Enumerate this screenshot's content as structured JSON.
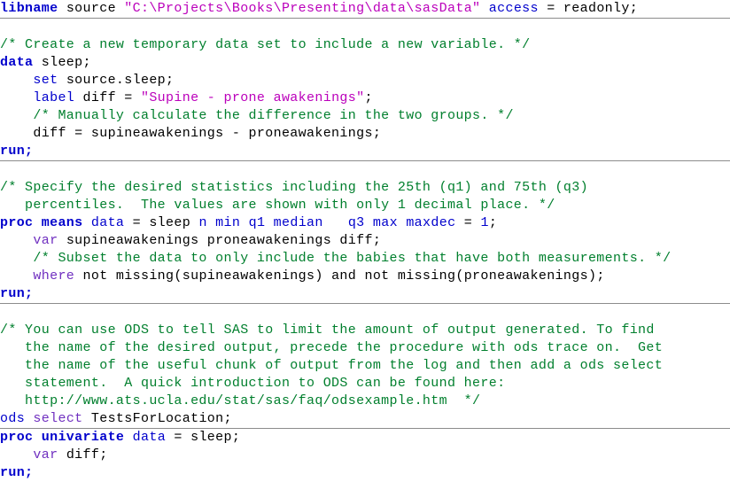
{
  "editor": {
    "title": "SAS Code Editor",
    "language": "SAS",
    "background_color": "#ffffff",
    "separator_color": "#8c8c8c",
    "colors": {
      "keyword": "#0000cc",
      "keyword_secondary": "#7030c0",
      "string": "#bb00bb",
      "comment": "#007f2d",
      "number": "#0000cc",
      "plain_text": "#000000"
    }
  },
  "lines": [
    {
      "id": "line-1",
      "rule_below": true,
      "tokens": [
        {
          "t": "libname",
          "c": "kw"
        },
        {
          "t": " source ",
          "c": "plain"
        },
        {
          "t": "\"C:\\Projects\\Books\\Presenting\\data\\sasData\"",
          "c": "str"
        },
        {
          "t": " ",
          "c": "plain"
        },
        {
          "t": "access",
          "c": "kw2"
        },
        {
          "t": " = readonly;",
          "c": "plain"
        }
      ]
    },
    {
      "id": "line-2",
      "rule_below": false,
      "tokens": [
        {
          "t": " ",
          "c": "plain"
        }
      ]
    },
    {
      "id": "line-3",
      "rule_below": false,
      "tokens": [
        {
          "t": "/* Create a new temporary data set to include a new variable. */",
          "c": "cmt"
        }
      ]
    },
    {
      "id": "line-4",
      "rule_below": false,
      "tokens": [
        {
          "t": "data",
          "c": "kw"
        },
        {
          "t": " sleep;",
          "c": "plain"
        }
      ]
    },
    {
      "id": "line-5",
      "rule_below": false,
      "tokens": [
        {
          "t": "    ",
          "c": "plain"
        },
        {
          "t": "set",
          "c": "kw2"
        },
        {
          "t": " source.sleep;",
          "c": "plain"
        }
      ]
    },
    {
      "id": "line-6",
      "rule_below": false,
      "tokens": [
        {
          "t": "    ",
          "c": "plain"
        },
        {
          "t": "label",
          "c": "kw2"
        },
        {
          "t": " diff = ",
          "c": "plain"
        },
        {
          "t": "\"Supine - prone awakenings\"",
          "c": "str"
        },
        {
          "t": ";",
          "c": "plain"
        }
      ]
    },
    {
      "id": "line-7",
      "rule_below": false,
      "tokens": [
        {
          "t": "    ",
          "c": "plain"
        },
        {
          "t": "/* Manually calculate the difference in the two groups. */",
          "c": "cmt"
        }
      ]
    },
    {
      "id": "line-8",
      "rule_below": false,
      "tokens": [
        {
          "t": "    diff = supineawakenings - proneawakenings;",
          "c": "plain"
        }
      ]
    },
    {
      "id": "line-9",
      "rule_below": true,
      "tokens": [
        {
          "t": "run;",
          "c": "kw"
        }
      ]
    },
    {
      "id": "line-10",
      "rule_below": false,
      "tokens": [
        {
          "t": " ",
          "c": "plain"
        }
      ]
    },
    {
      "id": "line-11",
      "rule_below": false,
      "tokens": [
        {
          "t": "/* Specify the desired statistics including the 25th (q1) and 75th (q3)",
          "c": "cmt"
        }
      ]
    },
    {
      "id": "line-12",
      "rule_below": false,
      "tokens": [
        {
          "t": "   percentiles.  The values are shown with only 1 decimal place. */",
          "c": "cmt"
        }
      ]
    },
    {
      "id": "line-13",
      "rule_below": false,
      "tokens": [
        {
          "t": "proc means",
          "c": "kw"
        },
        {
          "t": " ",
          "c": "plain"
        },
        {
          "t": "data",
          "c": "kw2"
        },
        {
          "t": " = sleep ",
          "c": "plain"
        },
        {
          "t": "n",
          "c": "kw2"
        },
        {
          "t": " ",
          "c": "plain"
        },
        {
          "t": "min",
          "c": "kw2"
        },
        {
          "t": " ",
          "c": "plain"
        },
        {
          "t": "q1",
          "c": "kw2"
        },
        {
          "t": " ",
          "c": "plain"
        },
        {
          "t": "median",
          "c": "kw2"
        },
        {
          "t": "   ",
          "c": "plain"
        },
        {
          "t": "q3",
          "c": "kw2"
        },
        {
          "t": " ",
          "c": "plain"
        },
        {
          "t": "max",
          "c": "kw2"
        },
        {
          "t": " ",
          "c": "plain"
        },
        {
          "t": "maxdec",
          "c": "kw2"
        },
        {
          "t": " = ",
          "c": "plain"
        },
        {
          "t": "1",
          "c": "num"
        },
        {
          "t": ";",
          "c": "plain"
        }
      ]
    },
    {
      "id": "line-14",
      "rule_below": false,
      "tokens": [
        {
          "t": "    ",
          "c": "plain"
        },
        {
          "t": "var",
          "c": "opt"
        },
        {
          "t": " supineawakenings proneawakenings diff;",
          "c": "plain"
        }
      ]
    },
    {
      "id": "line-15",
      "rule_below": false,
      "tokens": [
        {
          "t": "    ",
          "c": "plain"
        },
        {
          "t": "/* Subset the data to only include the babies that have both measurements. */",
          "c": "cmt"
        }
      ]
    },
    {
      "id": "line-16",
      "rule_below": false,
      "tokens": [
        {
          "t": "    ",
          "c": "plain"
        },
        {
          "t": "where",
          "c": "opt"
        },
        {
          "t": " not missing(supineawakenings) and not missing(proneawakenings);",
          "c": "plain"
        }
      ]
    },
    {
      "id": "line-17",
      "rule_below": true,
      "tokens": [
        {
          "t": "run;",
          "c": "kw"
        }
      ]
    },
    {
      "id": "line-18",
      "rule_below": false,
      "tokens": [
        {
          "t": " ",
          "c": "plain"
        }
      ]
    },
    {
      "id": "line-19",
      "rule_below": false,
      "tokens": [
        {
          "t": "/* You can use ODS to tell SAS to limit the amount of output generated. To find",
          "c": "cmt"
        }
      ]
    },
    {
      "id": "line-20",
      "rule_below": false,
      "tokens": [
        {
          "t": "   the name of the desired output, precede the procedure with ods trace on.  Get",
          "c": "cmt"
        }
      ]
    },
    {
      "id": "line-21",
      "rule_below": false,
      "tokens": [
        {
          "t": "   the name of the useful chunk of output from the log and then add a ods select",
          "c": "cmt"
        }
      ]
    },
    {
      "id": "line-22",
      "rule_below": false,
      "tokens": [
        {
          "t": "   statement.  A quick introduction to ODS can be found here:",
          "c": "cmt"
        }
      ]
    },
    {
      "id": "line-23",
      "rule_below": false,
      "tokens": [
        {
          "t": "   http://www.ats.ucla.edu/stat/sas/faq/odsexample.htm  */",
          "c": "cmt"
        }
      ]
    },
    {
      "id": "line-24",
      "rule_below": true,
      "tokens": [
        {
          "t": "ods",
          "c": "kw2"
        },
        {
          "t": " ",
          "c": "plain"
        },
        {
          "t": "select",
          "c": "opt"
        },
        {
          "t": " TestsForLocation;",
          "c": "plain"
        }
      ]
    },
    {
      "id": "line-25",
      "rule_below": false,
      "tokens": [
        {
          "t": "proc univariate",
          "c": "kw"
        },
        {
          "t": " ",
          "c": "plain"
        },
        {
          "t": "data",
          "c": "kw2"
        },
        {
          "t": " = sleep;",
          "c": "plain"
        }
      ]
    },
    {
      "id": "line-26",
      "rule_below": false,
      "tokens": [
        {
          "t": "    ",
          "c": "plain"
        },
        {
          "t": "var",
          "c": "opt"
        },
        {
          "t": " diff;",
          "c": "plain"
        }
      ]
    },
    {
      "id": "line-27",
      "rule_below": false,
      "tokens": [
        {
          "t": "run;",
          "c": "kw"
        }
      ]
    }
  ]
}
